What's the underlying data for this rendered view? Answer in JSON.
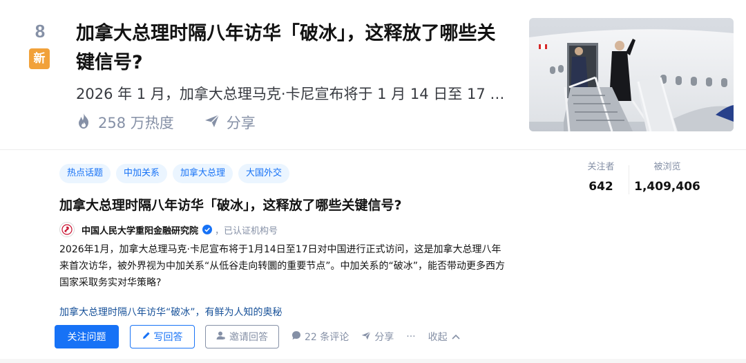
{
  "hot": {
    "rank": "8",
    "badge": "新",
    "title": "加拿大总理时隔八年访华「破冰」，这释放了哪些关键信号?",
    "excerpt": "2026 年 1 月，加拿大总理马克·卡尼宣布将于 1 月 14 日至 17 日对中国进行正式访问，这是加拿大总理八年来首次访华...",
    "heat": "258 万热度",
    "share": "分享",
    "thumbnail_icon": "airplane-stairs-photo"
  },
  "question": {
    "topics": [
      "热点话题",
      "中加关系",
      "加拿大总理",
      "大国外交"
    ],
    "title": "加拿大总理时隔八年访华「破冰」，这释放了哪些关键信号?",
    "author": {
      "name": "中国人民大学重阳金融研究院",
      "tag": "，已认证机构号"
    },
    "detail": "2026年1月，加拿大总理马克·卡尼宣布将于1月14日至17日对中国进行正式访问，这是加拿大总理八年来首次访华，被外界视为中加关系“从低谷走向转圜的重要节点”。中加关系的“破冰”，能否带动更多西方国家采取务实对华策略?",
    "related_link": "加拿大总理时隔八年访华“破冰”，有鲜为人知的奥秘",
    "stats": {
      "followers_label": "关注者",
      "followers": "642",
      "views_label": "被浏览",
      "views": "1,409,406"
    },
    "actions": {
      "follow": "关注问题",
      "write": "写回答",
      "invite": "邀请回答",
      "comments": "22 条评论",
      "share": "分享",
      "more": "···",
      "collapse": "收起"
    }
  },
  "colors": {
    "accent": "#1772f6",
    "badge": "#f1a13a",
    "muted": "#8590a6",
    "link": "#175199"
  }
}
